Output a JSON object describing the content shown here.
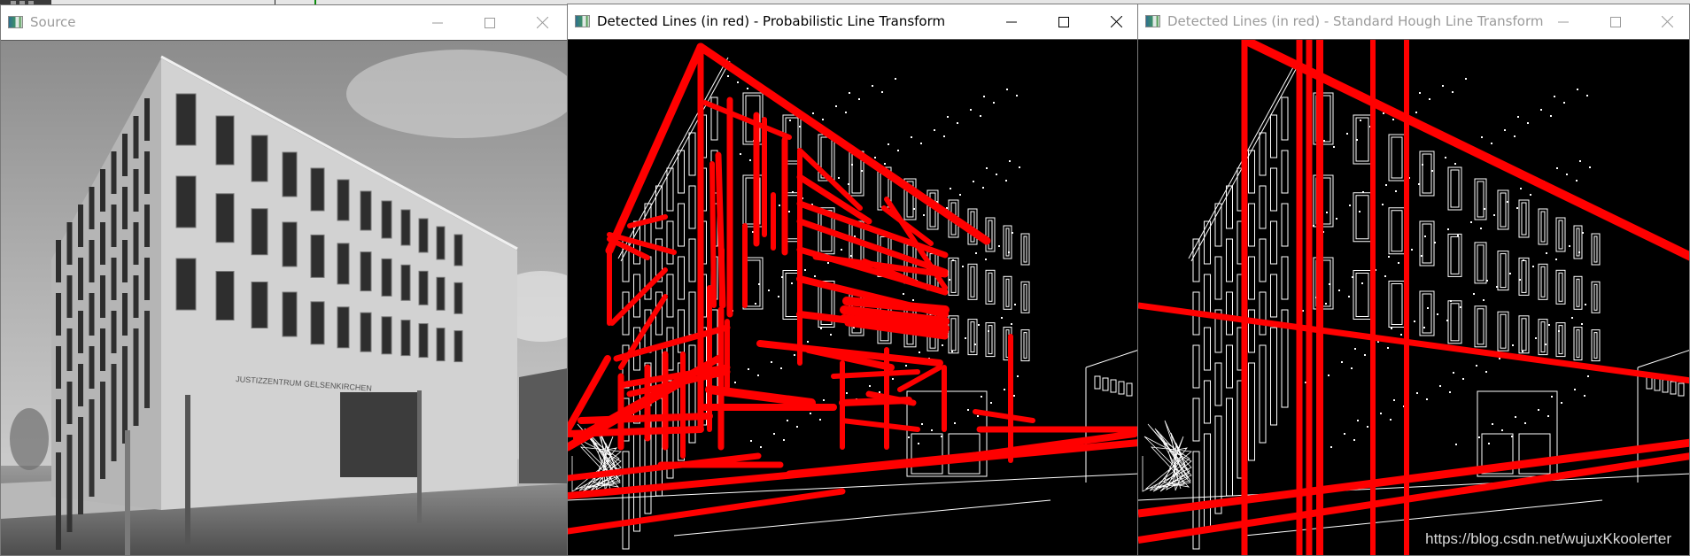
{
  "windows": [
    {
      "id": "source",
      "title": "Source",
      "icon": "opencv-window-icon",
      "active": false,
      "controls": [
        "minimize-icon",
        "maximize-icon",
        "close-icon"
      ],
      "content": {
        "type": "grayscale-photo",
        "subject": "office building",
        "facade_text": "JUSTIZZENTRUM GELSENKIRCHEN"
      }
    },
    {
      "id": "probabilistic",
      "title": "Detected Lines (in red) - Probabilistic Line Transform",
      "icon": "opencv-window-icon",
      "active": true,
      "controls": [
        "minimize-icon",
        "maximize-icon",
        "close-icon"
      ],
      "content": {
        "type": "edge-map-with-line-segments",
        "line_color": "#ff0000",
        "edge_color": "#ffffff",
        "background": "#000000"
      }
    },
    {
      "id": "standard",
      "title": "Detected Lines (in red) - Standard Hough Line Transform",
      "icon": "opencv-window-icon",
      "active": false,
      "controls": [
        "minimize-icon",
        "maximize-icon",
        "close-icon"
      ],
      "content": {
        "type": "edge-map-with-infinite-lines",
        "line_color": "#ff0000",
        "edge_color": "#ffffff",
        "background": "#000000"
      }
    }
  ],
  "watermark": "https://blog.csdn.net/wujuxKkoolerter",
  "colors": {
    "titlebar": "#ffffff",
    "title_active": "#000000",
    "title_inactive": "#9a9a9a",
    "detected_line": "#ff0000"
  }
}
